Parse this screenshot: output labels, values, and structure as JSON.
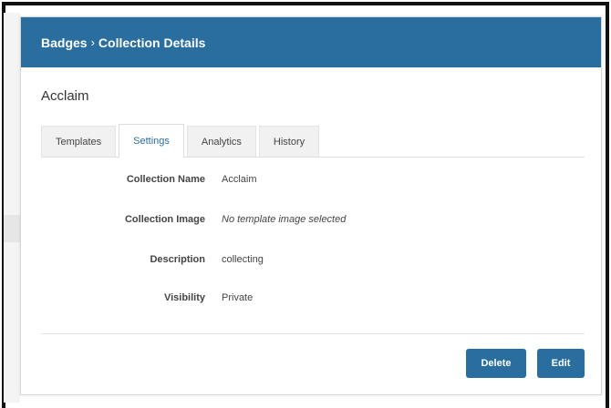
{
  "header": {
    "breadcrumb": [
      {
        "label": "Badges"
      },
      {
        "label": "Collection Details"
      }
    ],
    "separator": "›"
  },
  "title": "Acclaim",
  "tabs": [
    {
      "label": "Templates",
      "active": false
    },
    {
      "label": "Settings",
      "active": true
    },
    {
      "label": "Analytics",
      "active": false
    },
    {
      "label": "History",
      "active": false
    }
  ],
  "fields": {
    "collection_name": {
      "label": "Collection Name",
      "value": "Acclaim"
    },
    "collection_image": {
      "label": "Collection Image",
      "value": "No template image selected"
    },
    "description": {
      "label": "Description",
      "value": "collecting"
    },
    "visibility": {
      "label": "Visibility",
      "value": "Private"
    }
  },
  "actions": {
    "delete_label": "Delete",
    "edit_label": "Edit"
  },
  "colors": {
    "header_bg": "#2a6d9f",
    "button_bg": "#2a6d9f",
    "active_tab_text": "#2a6d9f"
  }
}
